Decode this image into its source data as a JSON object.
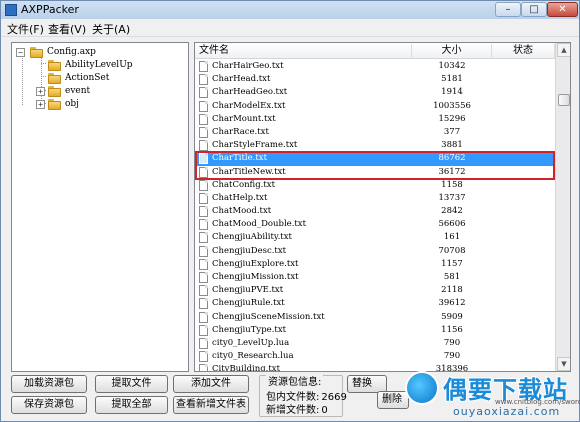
{
  "window": {
    "title": "AXPPacker",
    "min": "–",
    "max": "□",
    "close": "✕"
  },
  "menu": {
    "items": [
      "文件(F)",
      "查看(V)",
      "关于(A)"
    ]
  },
  "tree": {
    "root": "Config.axp",
    "children": [
      "AbilityLevelUp",
      "ActionSet",
      "event",
      "obj"
    ]
  },
  "list": {
    "headers": {
      "name": "文件名",
      "size": "大小",
      "status": "状态"
    },
    "rows": [
      {
        "name": "CharHairGeo.txt",
        "size": "10342"
      },
      {
        "name": "CharHead.txt",
        "size": "5181"
      },
      {
        "name": "CharHeadGeo.txt",
        "size": "1914"
      },
      {
        "name": "CharModelEx.txt",
        "size": "1003556"
      },
      {
        "name": "CharMount.txt",
        "size": "15296"
      },
      {
        "name": "CharRace.txt",
        "size": "377"
      },
      {
        "name": "CharStyleFrame.txt",
        "size": "3881"
      },
      {
        "name": "CharTitle.txt",
        "size": "86762"
      },
      {
        "name": "CharTitleNew.txt",
        "size": "36172"
      },
      {
        "name": "ChatConfig.txt",
        "size": "1158"
      },
      {
        "name": "ChatHelp.txt",
        "size": "13737"
      },
      {
        "name": "ChatMood.txt",
        "size": "2842"
      },
      {
        "name": "ChatMood_Double.txt",
        "size": "56606"
      },
      {
        "name": "ChengjiuAbility.txt",
        "size": "161"
      },
      {
        "name": "ChengjiuDesc.txt",
        "size": "70708"
      },
      {
        "name": "ChengjiuExplore.txt",
        "size": "1157"
      },
      {
        "name": "ChengjiuMission.txt",
        "size": "581"
      },
      {
        "name": "ChengjiuPVE.txt",
        "size": "2118"
      },
      {
        "name": "ChengjiuRule.txt",
        "size": "39612"
      },
      {
        "name": "ChengjiuSceneMission.txt",
        "size": "5909"
      },
      {
        "name": "ChengjiuType.txt",
        "size": "1156"
      },
      {
        "name": "city0_LevelUp.lua",
        "size": "790"
      },
      {
        "name": "city0_Research.lua",
        "size": "790"
      },
      {
        "name": "CityBuilding.txt",
        "size": "318396"
      }
    ],
    "selected_row": "CharTitle.txt"
  },
  "buttons": {
    "load": "加载资源包",
    "extract": "提取文件",
    "add": "添加文件",
    "save": "保存资源包",
    "extract_all": "提取全部",
    "view_new": "查看新增文件表"
  },
  "info": {
    "title": "资源包信息:",
    "count_label": "包内文件数:",
    "count_value": "2669",
    "new_label": "新增文件数:",
    "new_value": "0"
  },
  "partial_buttons": {
    "p1": "替换",
    "p2": "删除"
  },
  "watermark": {
    "main": "偶要下载站",
    "sub": "ouyaoxiazai.com",
    "blog": "www.cnitblog.com/sword"
  },
  "colors": {
    "selection": "#3399ff",
    "highlight_box": "#d2232a",
    "watermark": "#1a8bd9"
  }
}
